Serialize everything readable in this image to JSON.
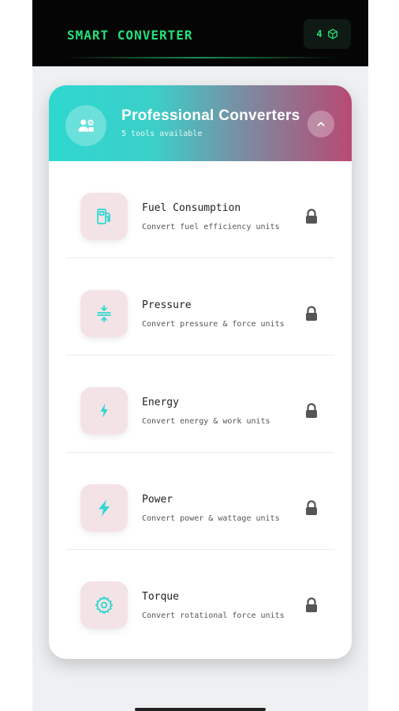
{
  "app": {
    "title": "SMART CONVERTER",
    "coins": "4",
    "coin_icon": "cube-icon",
    "accent": "#22e07a"
  },
  "section": {
    "title": "Professional Converters",
    "subtitle": "5 tools available",
    "header_icon": "users-settings-icon",
    "toggle_icon": "chevron-up-icon",
    "gradient_start": "#2ed8cf",
    "gradient_end": "#b84a74"
  },
  "tools": [
    {
      "title": "Fuel Consumption",
      "subtitle": "Convert fuel efficiency units",
      "icon": "fuel-pump-icon",
      "locked": true
    },
    {
      "title": "Pressure",
      "subtitle": "Convert pressure & force units",
      "icon": "compress-icon",
      "locked": true
    },
    {
      "title": "Energy",
      "subtitle": "Convert energy & work units",
      "icon": "bolt-icon",
      "locked": true
    },
    {
      "title": "Power",
      "subtitle": "Convert power & wattage units",
      "icon": "lightning-icon",
      "locked": true
    },
    {
      "title": "Torque",
      "subtitle": "Convert rotational force units",
      "icon": "gear-icon",
      "locked": true
    }
  ]
}
